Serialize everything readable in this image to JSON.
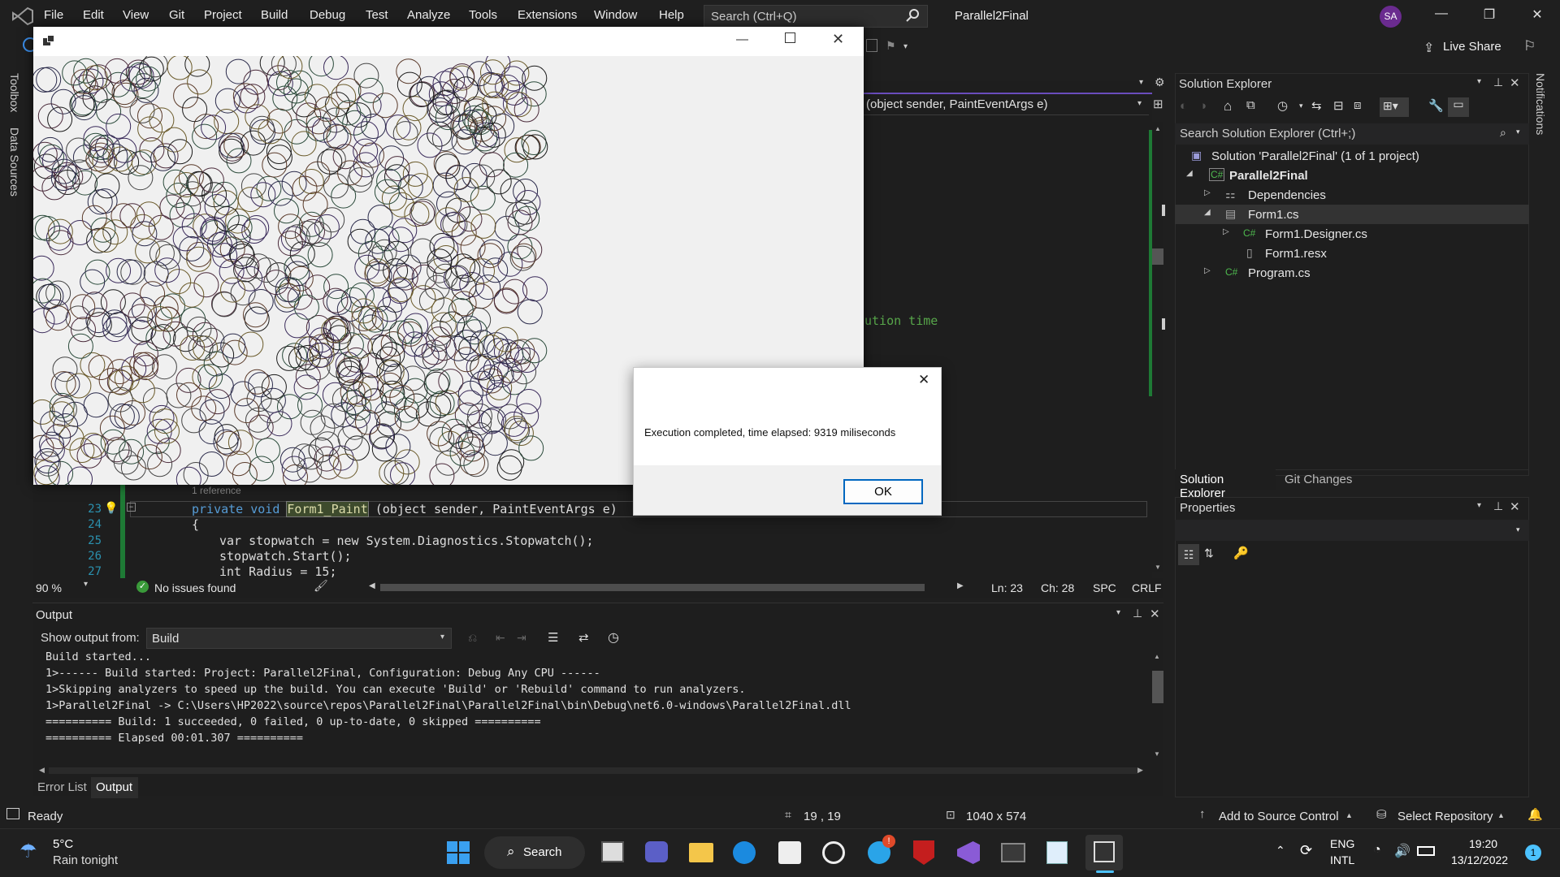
{
  "menu": [
    "File",
    "Edit",
    "View",
    "Git",
    "Project",
    "Build",
    "Debug",
    "Test",
    "Analyze",
    "Tools",
    "Extensions",
    "Window",
    "Help"
  ],
  "search_placeholder": "Search (Ctrl+Q)",
  "solution_name": "Parallel2Final",
  "avatar_initials": "SA",
  "live_share": "Live Share",
  "left_tabs": [
    "Toolbox",
    "Data Sources"
  ],
  "right_tab": "Notifications",
  "editor": {
    "nav_method": "(object sender, PaintEventArgs e)",
    "comment_fragment": "ution time",
    "codelens": "1 reference",
    "lines": [
      {
        "n": "23",
        "kw": "private void ",
        "fn": "Form1_Paint",
        "rest": " (object sender, PaintEventArgs e)"
      },
      {
        "n": "24",
        "text": "{"
      },
      {
        "n": "25",
        "text": "var stopwatch = new System.Diagnostics.Stopwatch();"
      },
      {
        "n": "26",
        "text": "stopwatch.Start();"
      },
      {
        "n": "27",
        "text": "int Radius = 15;"
      }
    ],
    "zoom": "90 %",
    "issues": "No issues found",
    "ln": "Ln: 23",
    "ch": "Ch: 28",
    "spc": "SPC",
    "crlf": "CRLF"
  },
  "output": {
    "title": "Output",
    "show_from": "Show output from:",
    "source": "Build",
    "lines": [
      "Build started...",
      "1>------ Build started: Project: Parallel2Final, Configuration: Debug Any CPU ------",
      "1>Skipping analyzers to speed up the build. You can execute 'Build' or 'Rebuild' command to run analyzers.",
      "1>Parallel2Final -> C:\\Users\\HP2022\\source\\repos\\Parallel2Final\\Parallel2Final\\bin\\Debug\\net6.0-windows\\Parallel2Final.dll",
      "========== Build: 1 succeeded, 0 failed, 0 up-to-date, 0 skipped ==========",
      "========== Elapsed 00:01.307 =========="
    ],
    "tabs": [
      "Error List",
      "Output"
    ]
  },
  "solution_explorer": {
    "title": "Solution Explorer",
    "search": "Search Solution Explorer (Ctrl+;)",
    "items": [
      {
        "label": "Solution 'Parallel2Final' (1 of 1 project)"
      },
      {
        "label": "Parallel2Final"
      },
      {
        "label": "Dependencies"
      },
      {
        "label": "Form1.cs"
      },
      {
        "label": "Form1.Designer.cs"
      },
      {
        "label": "Form1.resx"
      },
      {
        "label": "Program.cs"
      }
    ],
    "tabs": [
      "Solution Explorer",
      "Git Changes"
    ]
  },
  "properties": {
    "title": "Properties"
  },
  "status": {
    "ready": "Ready",
    "position": "19 , 19",
    "size": "1040 x 574",
    "source_control": "Add to Source Control",
    "repo": "Select Repository"
  },
  "dialog": {
    "message": "Execution completed, time elapsed: 9319 miliseconds",
    "ok": "OK"
  },
  "taskbar": {
    "weather_temp": "5°C",
    "weather_desc": "Rain tonight",
    "search": "Search",
    "lang1": "ENG",
    "lang2": "INTL",
    "time": "19:20",
    "date": "13/12/2022",
    "notif_count": "1",
    "badge": "!"
  },
  "colors": {
    "accent": "#0067c0",
    "vs_purple": "#6a2b8f",
    "comment": "#57a64a"
  }
}
